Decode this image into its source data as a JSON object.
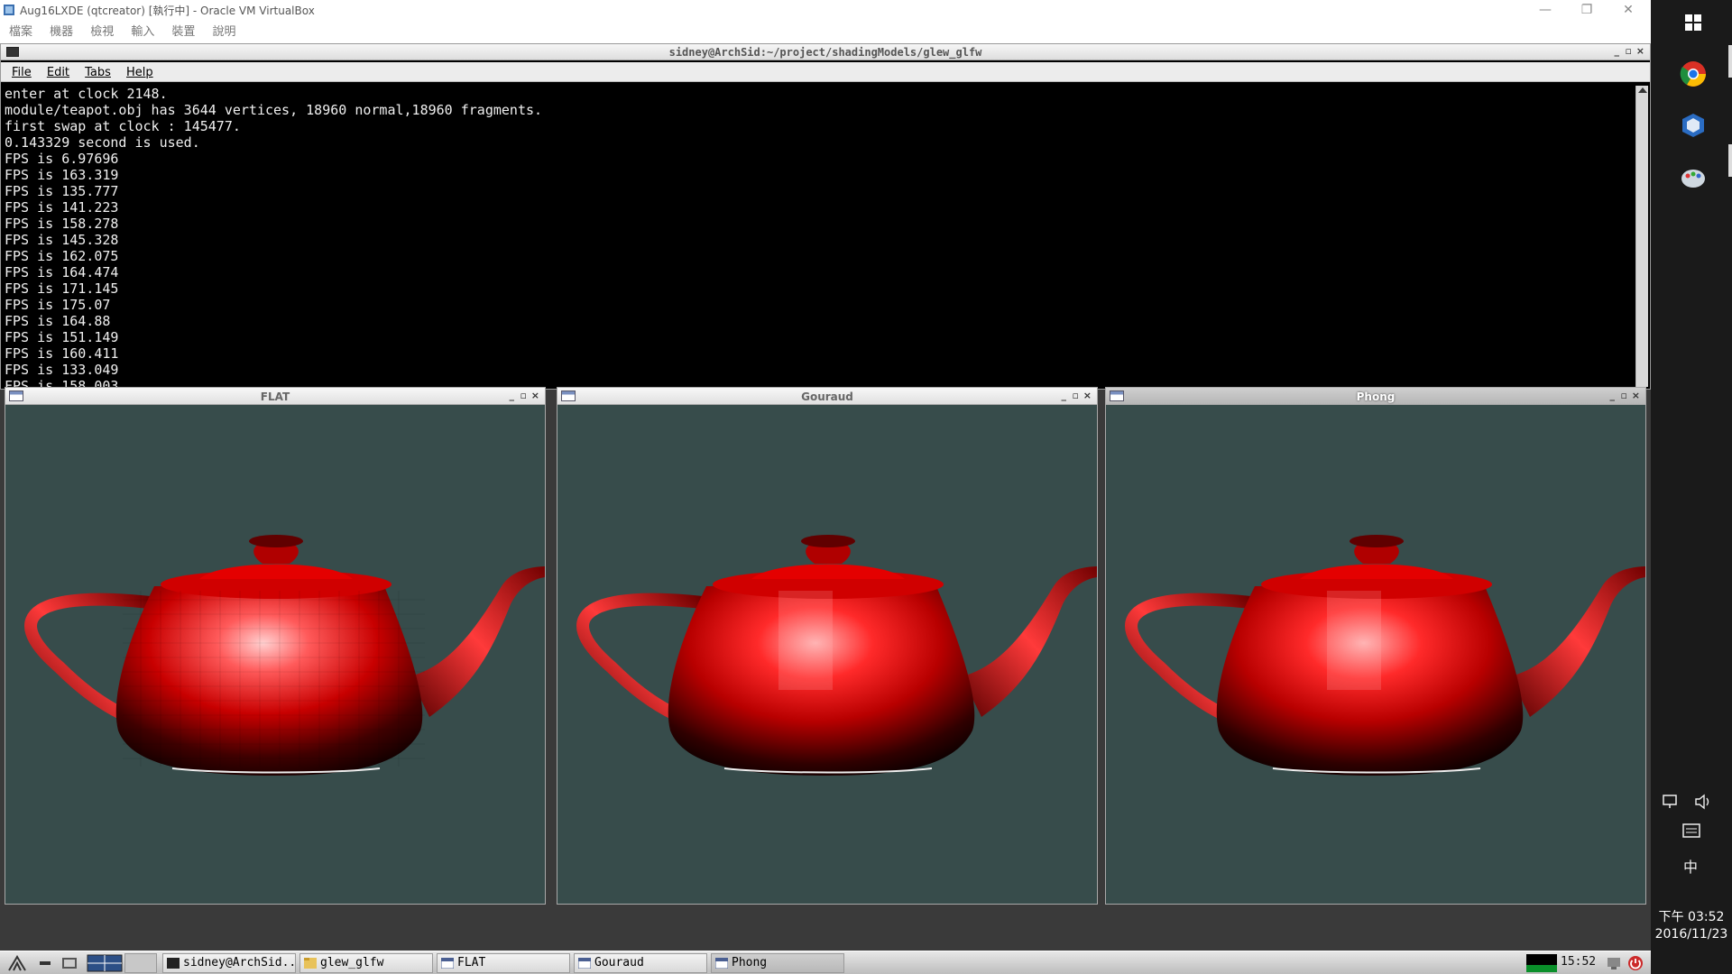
{
  "host": {
    "title": "Aug16LXDE (qtcreator) [執行中] - Oracle VM VirtualBox",
    "menu": [
      "檔案",
      "機器",
      "檢視",
      "輸入",
      "裝置",
      "說明"
    ],
    "controls": {
      "minimize": "—",
      "restore": "❐",
      "close": "✕"
    }
  },
  "terminal": {
    "title": "sidney@ArchSid:~/project/shadingModels/glew_glfw",
    "menu": [
      "File",
      "Edit",
      "Tabs",
      "Help"
    ],
    "controls": {
      "minimize": "_",
      "maximize": "▫",
      "close": "×"
    },
    "output": "enter at clock 2148.\nmodule/teapot.obj has 3644 vertices, 18960 normal,18960 fragments.\nfirst swap at clock : 145477.\n0.143329 second is used.\nFPS is 6.97696\nFPS is 163.319\nFPS is 135.777\nFPS is 141.223\nFPS is 158.278\nFPS is 145.328\nFPS is 162.075\nFPS is 164.474\nFPS is 171.145\nFPS is 175.07\nFPS is 164.88\nFPS is 151.149\nFPS is 160.411\nFPS is 133.049\nFPS is 158.003"
  },
  "render_windows": [
    {
      "title": "FLAT",
      "shading": "flat",
      "active": false
    },
    {
      "title": "Gouraud",
      "shading": "gouraud",
      "active": false
    },
    {
      "title": "Phong",
      "shading": "phong",
      "active": true
    }
  ],
  "render_window_controls": {
    "minimize": "_",
    "maximize": "▫",
    "close": "×"
  },
  "colors": {
    "viewport_bg": "#374c4b",
    "teapot": "#d40000",
    "terminal_bg": "#000000"
  },
  "taskbar": {
    "items": [
      {
        "label": "sidney@ArchSid...",
        "icon": "terminal-icon"
      },
      {
        "label": "glew_glfw",
        "icon": "folder-icon"
      },
      {
        "label": "FLAT",
        "icon": "window-icon"
      },
      {
        "label": "Gouraud",
        "icon": "window-icon"
      },
      {
        "label": "Phong",
        "icon": "window-icon"
      }
    ],
    "clock": "15:52"
  },
  "windows_sidebar": {
    "apps": [
      "windows-start-icon",
      "chrome-icon",
      "virtualbox-icon",
      "paint-icon"
    ],
    "ime": "中",
    "time": "下午 03:52",
    "date": "2016/11/23"
  }
}
